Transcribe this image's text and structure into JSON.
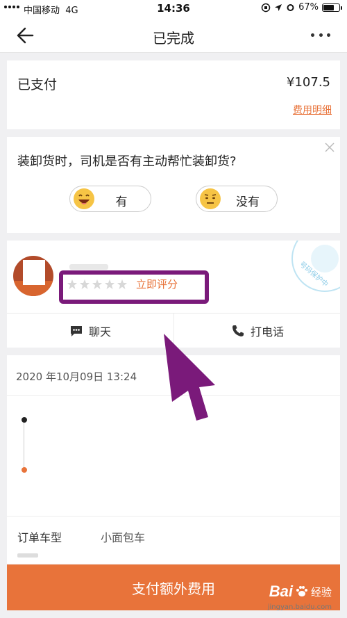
{
  "status_bar": {
    "carrier": "中国移动",
    "network": "4G",
    "time": "14:36",
    "battery": "67%",
    "battery_level": 0.67
  },
  "nav": {
    "title": "已完成",
    "back_icon": "arrow-left-icon",
    "more_icon": "more-dots-icon"
  },
  "payment": {
    "status": "已支付",
    "amount": "¥107.5",
    "detail_link": "费用明细"
  },
  "question": {
    "text": "装卸货时，司机是否有主动帮忙装卸货?",
    "options": [
      {
        "label": "有",
        "icon": "happy-emoji-icon"
      },
      {
        "label": "没有",
        "icon": "neutral-emoji-icon"
      }
    ]
  },
  "driver": {
    "rating_stars": 0,
    "rate_link": "立即评分",
    "seal_text": "号码保护中",
    "actions": {
      "chat": "聊天",
      "call": "打电话"
    }
  },
  "order": {
    "datetime": "2020 年10月09日 13:24",
    "vehicle_type_label": "订单车型",
    "vehicle_type_value": "小面包车"
  },
  "bottom_button": "支付额外费用",
  "watermark": {
    "logo": "Bai",
    "text": "经验",
    "url": "jingyan.baidu.com"
  },
  "colors": {
    "accent": "#e8733a",
    "highlight": "#7a1a7a",
    "background": "#f0f0f2"
  }
}
